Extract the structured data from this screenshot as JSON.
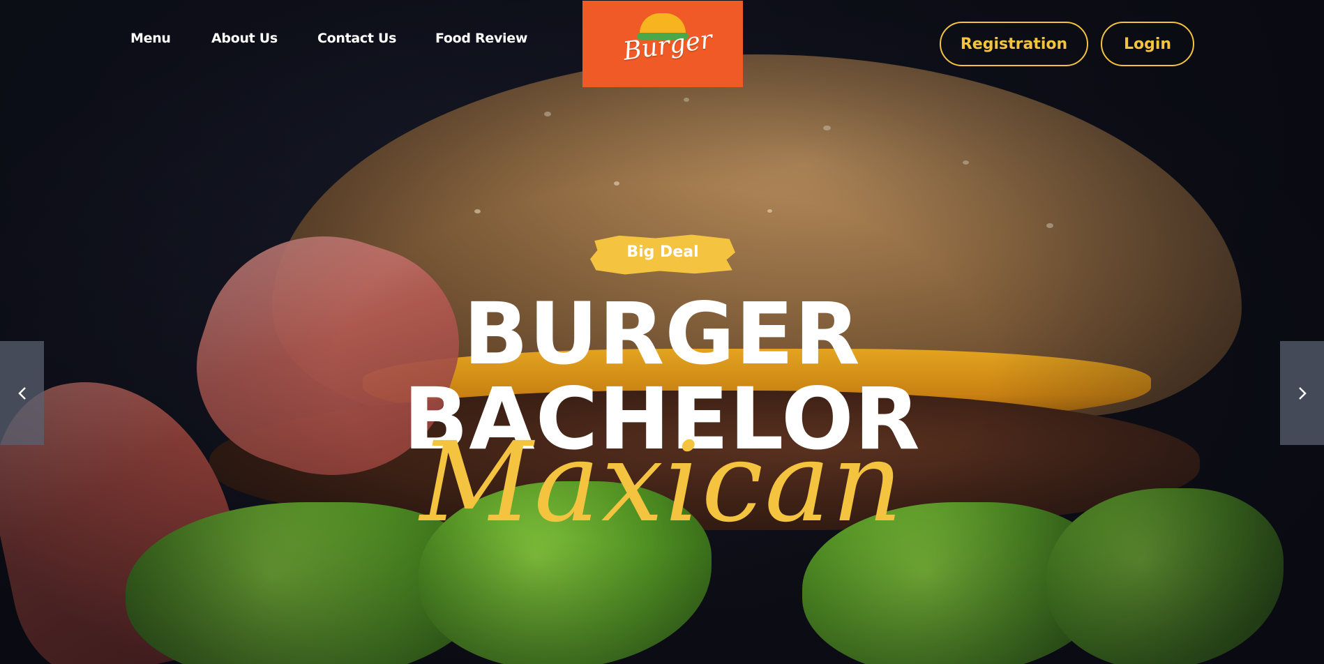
{
  "nav": {
    "items": [
      {
        "label": "Menu"
      },
      {
        "label": "About Us"
      },
      {
        "label": "Contact Us"
      },
      {
        "label": "Food Review"
      }
    ]
  },
  "logo": {
    "text": "Burger"
  },
  "auth": {
    "registration_label": "Registration",
    "login_label": "Login"
  },
  "hero": {
    "badge": "Big Deal",
    "title_line_1": "BURGER",
    "title_line_2": "BACHELOR",
    "script_text": "Maxican"
  },
  "slider": {
    "prev_icon": "chevron-left-icon",
    "next_icon": "chevron-right-icon"
  },
  "colors": {
    "accent": "#f4c441",
    "logo_bg": "#ef5a27",
    "background": "#0e0f17"
  }
}
